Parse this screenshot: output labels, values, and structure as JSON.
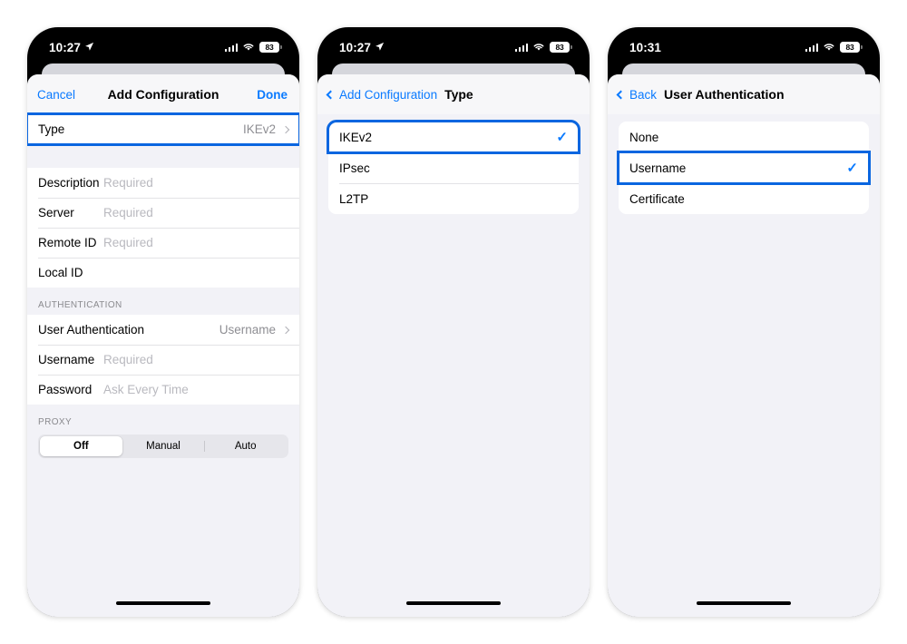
{
  "screens": [
    {
      "id": "add-configuration",
      "status": {
        "time": "10:27",
        "location_arrow": true,
        "battery": "83"
      },
      "nav": {
        "left": "Cancel",
        "title": "Add Configuration",
        "right": "Done"
      },
      "highlighted_row": "Type",
      "type_row": {
        "label": "Type",
        "value": "IKEv2"
      },
      "fields": [
        {
          "label": "Description",
          "placeholder": "Required"
        },
        {
          "label": "Server",
          "placeholder": "Required"
        },
        {
          "label": "Remote ID",
          "placeholder": "Required"
        },
        {
          "label": "Local ID",
          "placeholder": ""
        }
      ],
      "auth_header": "AUTHENTICATION",
      "auth_rows": [
        {
          "label": "User Authentication",
          "value": "Username",
          "chevron": true
        },
        {
          "label": "Username",
          "placeholder": "Required"
        },
        {
          "label": "Password",
          "placeholder": "Ask Every Time"
        }
      ],
      "proxy_header": "PROXY",
      "proxy_segments": [
        {
          "label": "Off",
          "active": true
        },
        {
          "label": "Manual",
          "active": false
        },
        {
          "label": "Auto",
          "active": false
        }
      ]
    },
    {
      "id": "type-picker",
      "status": {
        "time": "10:27",
        "location_arrow": true,
        "battery": "83"
      },
      "nav": {
        "back_label": "Add Configuration",
        "title": "Type"
      },
      "options": [
        {
          "label": "IKEv2",
          "selected": true,
          "highlighted": true
        },
        {
          "label": "IPsec",
          "selected": false,
          "highlighted": false
        },
        {
          "label": "L2TP",
          "selected": false,
          "highlighted": false
        }
      ]
    },
    {
      "id": "user-authentication-picker",
      "status": {
        "time": "10:31",
        "location_arrow": false,
        "battery": "83"
      },
      "nav": {
        "back_label": "Back",
        "title": "User Authentication"
      },
      "options": [
        {
          "label": "None",
          "selected": false,
          "highlighted": false
        },
        {
          "label": "Username",
          "selected": true,
          "highlighted": true
        },
        {
          "label": "Certificate",
          "selected": false,
          "highlighted": false
        }
      ]
    }
  ],
  "glyphs": {
    "checkmark": "✓",
    "location_arrow": "➤"
  },
  "colors": {
    "accent": "#0a7aff",
    "highlight": "#0a66e0",
    "sheet_bg": "#f2f2f7",
    "row_bg": "#ffffff"
  }
}
